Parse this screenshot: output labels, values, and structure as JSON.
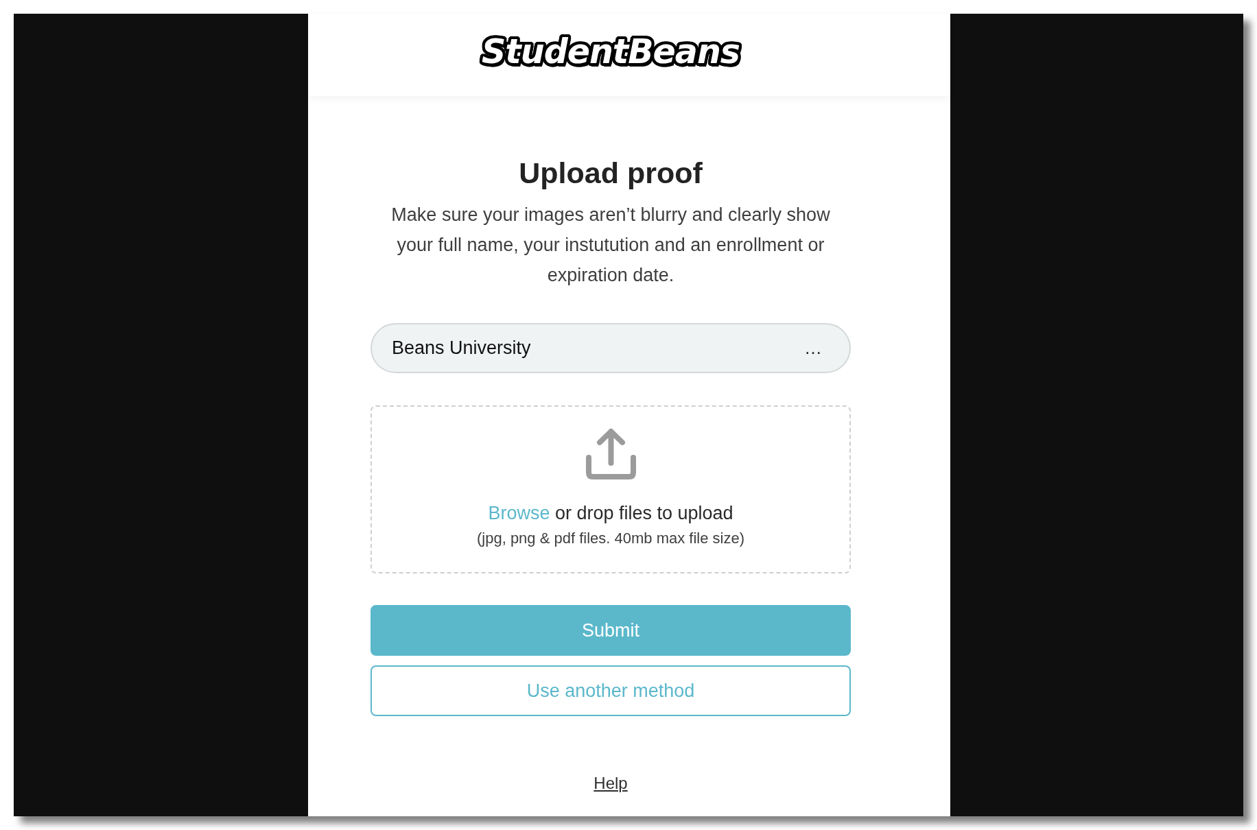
{
  "header": {
    "logo": "StudentBeans"
  },
  "title": "Upload proof",
  "instructions": "Make sure your images aren’t blurry and clearly show your full name, your instutution and an enrollment or expiration date.",
  "institution_field": {
    "value": "Beans University",
    "more": "…"
  },
  "dropzone": {
    "browse_link": "Browse",
    "prompt": "or drop files to upload",
    "hint": "(jpg, png & pdf files. 40mb max file size)"
  },
  "buttons": [
    {
      "kind": "primary",
      "label": "Submit"
    },
    {
      "kind": "secondary",
      "label": "Use another method"
    }
  ],
  "help_link": "Help"
}
